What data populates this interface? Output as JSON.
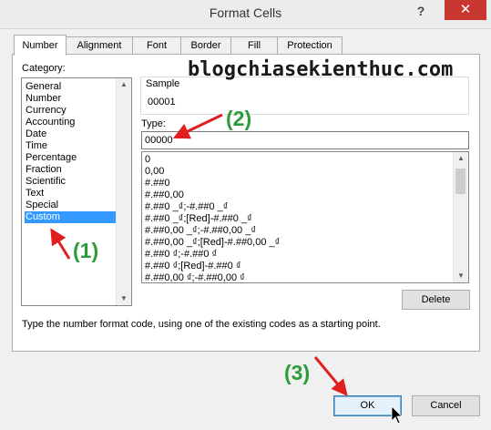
{
  "window": {
    "title": "Format Cells",
    "help": "?",
    "close": "✕"
  },
  "tabs": [
    "Number",
    "Alignment",
    "Font",
    "Border",
    "Fill",
    "Protection"
  ],
  "category": {
    "label": "Category:",
    "items": [
      "General",
      "Number",
      "Currency",
      "Accounting",
      "Date",
      "Time",
      "Percentage",
      "Fraction",
      "Scientific",
      "Text",
      "Special",
      "Custom"
    ],
    "selected": "Custom"
  },
  "sample": {
    "label": "Sample",
    "value": "00001"
  },
  "type": {
    "label": "Type:",
    "value": "00000",
    "formats": [
      "0",
      "0,00",
      "#.##0",
      "#.##0,00",
      "#.##0 _₫;-#.##0 _₫",
      "#.##0 _₫;[Red]-#.##0 _₫",
      "#.##0,00 _₫;-#.##0,00 _₫",
      "#.##0,00 _₫;[Red]-#.##0,00 _₫",
      "#.##0 ₫;-#.##0 ₫",
      "#.##0 ₫;[Red]-#.##0 ₫",
      "#.##0,00 ₫;-#.##0,00 ₫"
    ]
  },
  "buttons": {
    "delete": "Delete",
    "ok": "OK",
    "cancel": "Cancel"
  },
  "hint": "Type the number format code, using one of the existing codes as a starting point.",
  "watermark": "blogchiasekienthuc.com",
  "annotations": [
    "(1)",
    "(2)",
    "(3)"
  ],
  "colors": {
    "selection": "#3399ff",
    "annotation": "#2e9b3a",
    "arrow": "#e02020",
    "close": "#c7372f"
  }
}
